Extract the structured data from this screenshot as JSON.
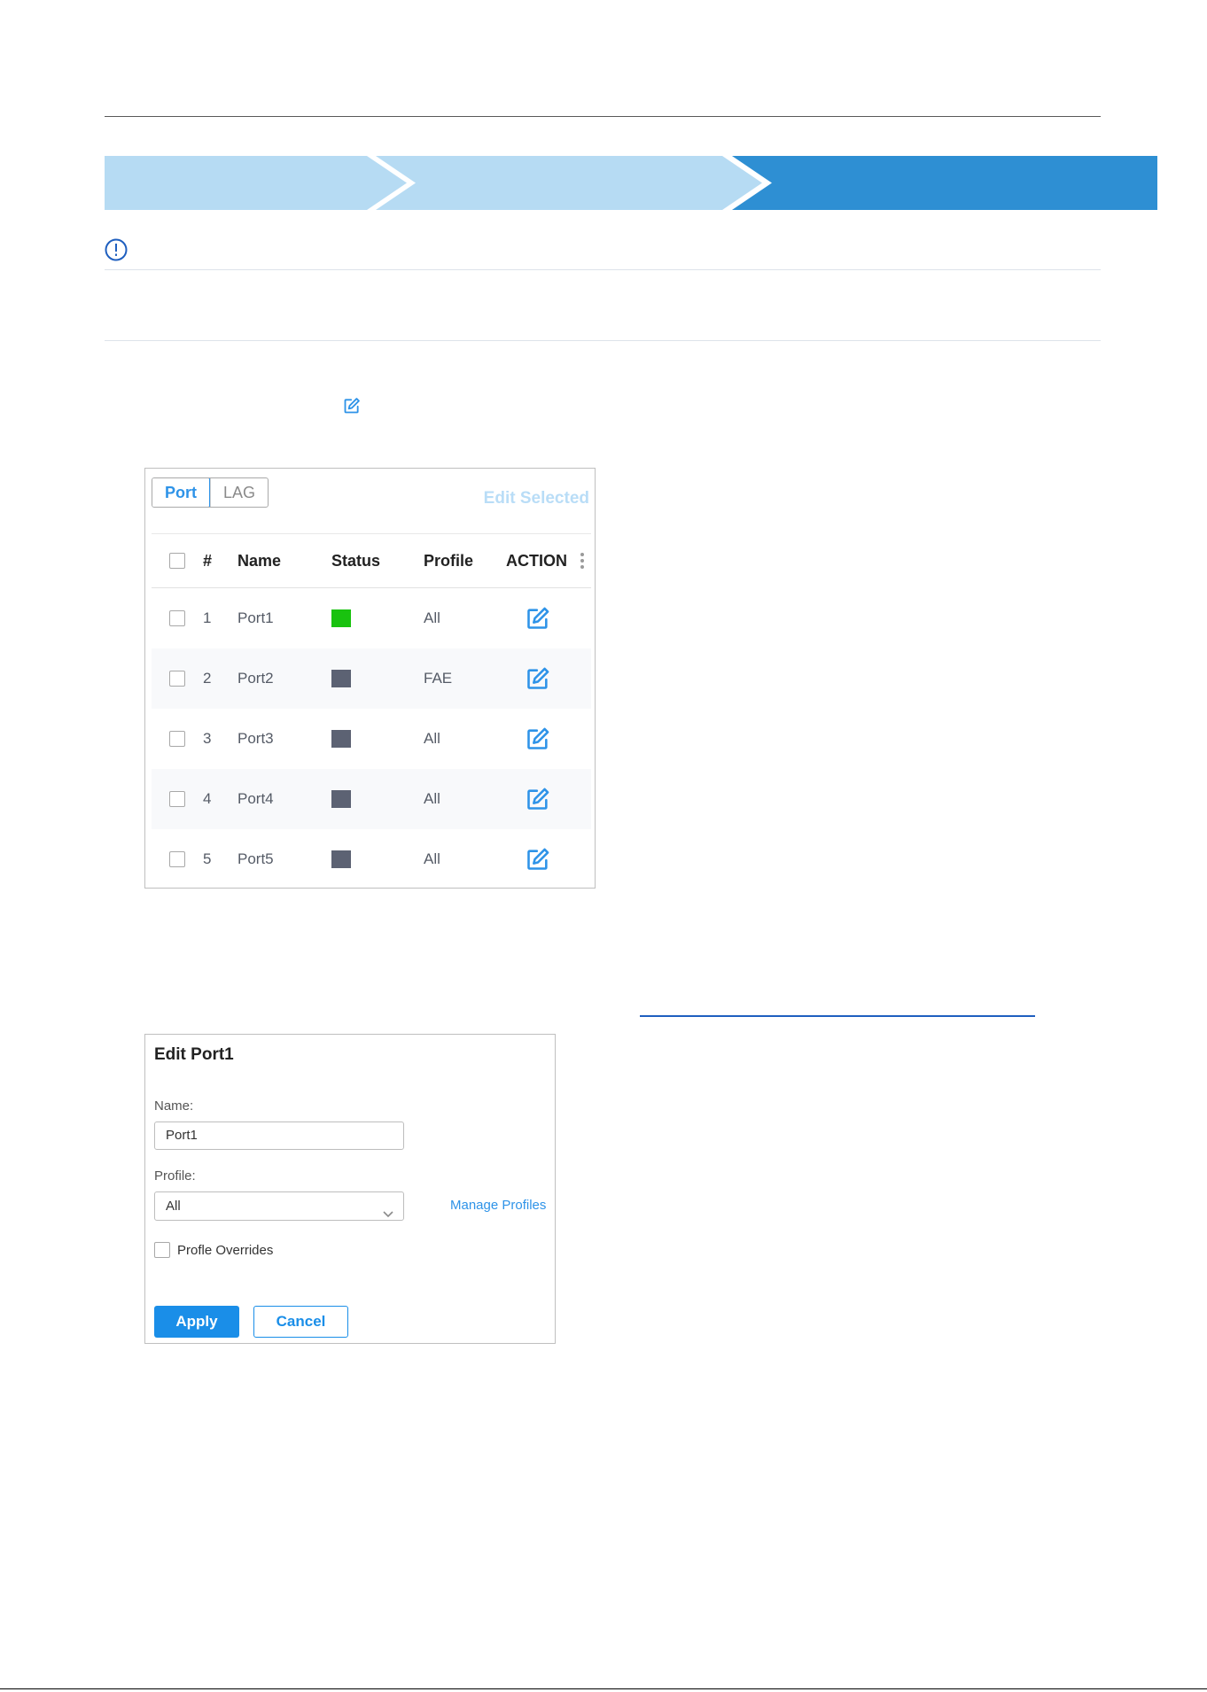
{
  "progress": {
    "steps_count": 3,
    "colors": {
      "done": "#b6dbf3",
      "current": "#2e8fd3"
    }
  },
  "notice": {
    "icon": "info-circle-icon"
  },
  "inline_icon": "edit-icon",
  "ports_panel": {
    "tabs": [
      {
        "label": "Port",
        "active": true
      },
      {
        "label": "LAG",
        "active": false
      }
    ],
    "edit_selected_label": "Edit Selected",
    "columns": [
      "#",
      "Name",
      "Status",
      "Profile",
      "ACTION"
    ],
    "more_icon": "vertical-dots-icon",
    "rows": [
      {
        "num": "1",
        "name": "Port1",
        "status": "up",
        "status_color": "#19c20f",
        "profile": "All"
      },
      {
        "num": "2",
        "name": "Port2",
        "status": "down",
        "status_color": "#5c6273",
        "profile": "FAE"
      },
      {
        "num": "3",
        "name": "Port3",
        "status": "down",
        "status_color": "#5c6273",
        "profile": "All"
      },
      {
        "num": "4",
        "name": "Port4",
        "status": "down",
        "status_color": "#5c6273",
        "profile": "All"
      },
      {
        "num": "5",
        "name": "Port5",
        "status": "down",
        "status_color": "#5c6273",
        "profile": "All"
      }
    ],
    "action_icon": "edit-icon",
    "accent_color": "#2e93e8"
  },
  "edit_panel": {
    "title": "Edit Port1",
    "name_label": "Name:",
    "name_value": "Port1",
    "profile_label": "Profile:",
    "profile_value": "All",
    "manage_profiles_label": "Manage Profiles",
    "override_label": "Profle Overrides",
    "apply_label": "Apply",
    "cancel_label": "Cancel"
  }
}
